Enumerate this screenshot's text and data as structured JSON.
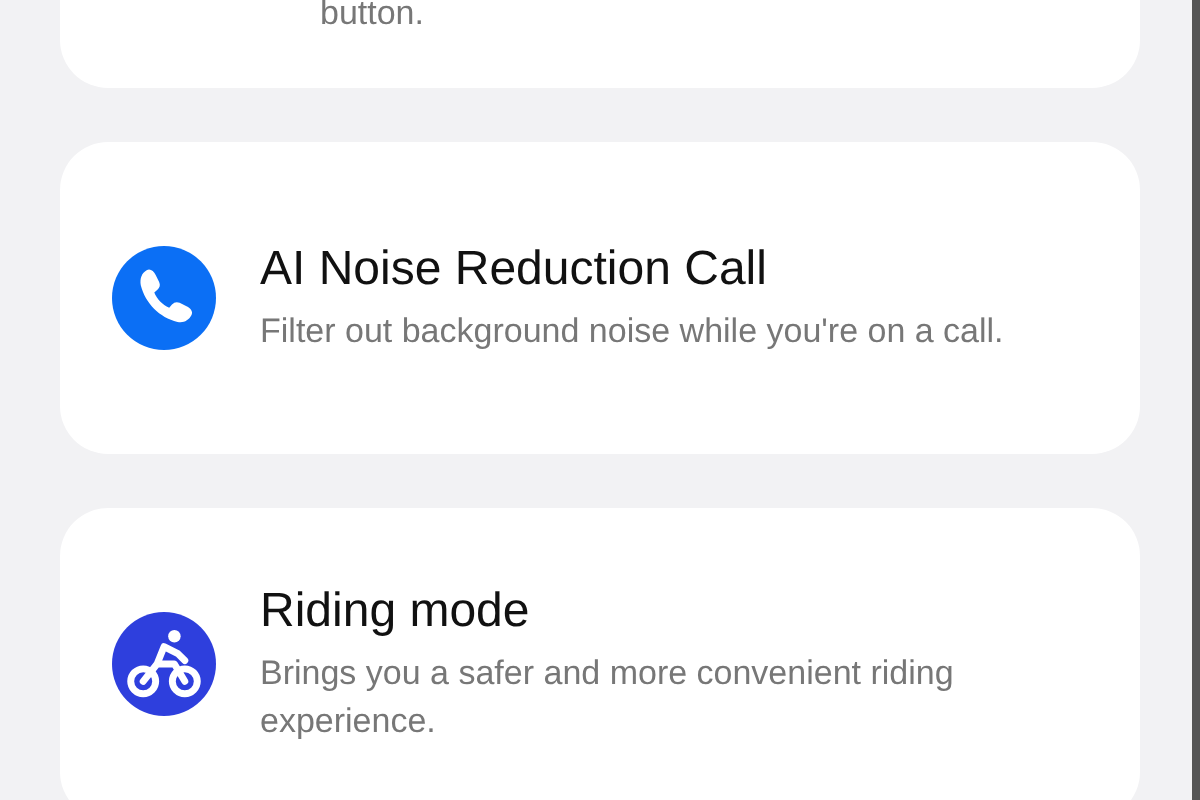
{
  "top_card": {
    "description": "button."
  },
  "features": [
    {
      "kind": "call",
      "title": "AI Noise Reduction Call",
      "description": "Filter out background noise while you're on a call.",
      "color": "#0b6ff5"
    },
    {
      "kind": "riding",
      "title": "Riding mode",
      "description": "Brings you a safer and more convenient riding experience.",
      "color": "#2e3fdd"
    }
  ]
}
